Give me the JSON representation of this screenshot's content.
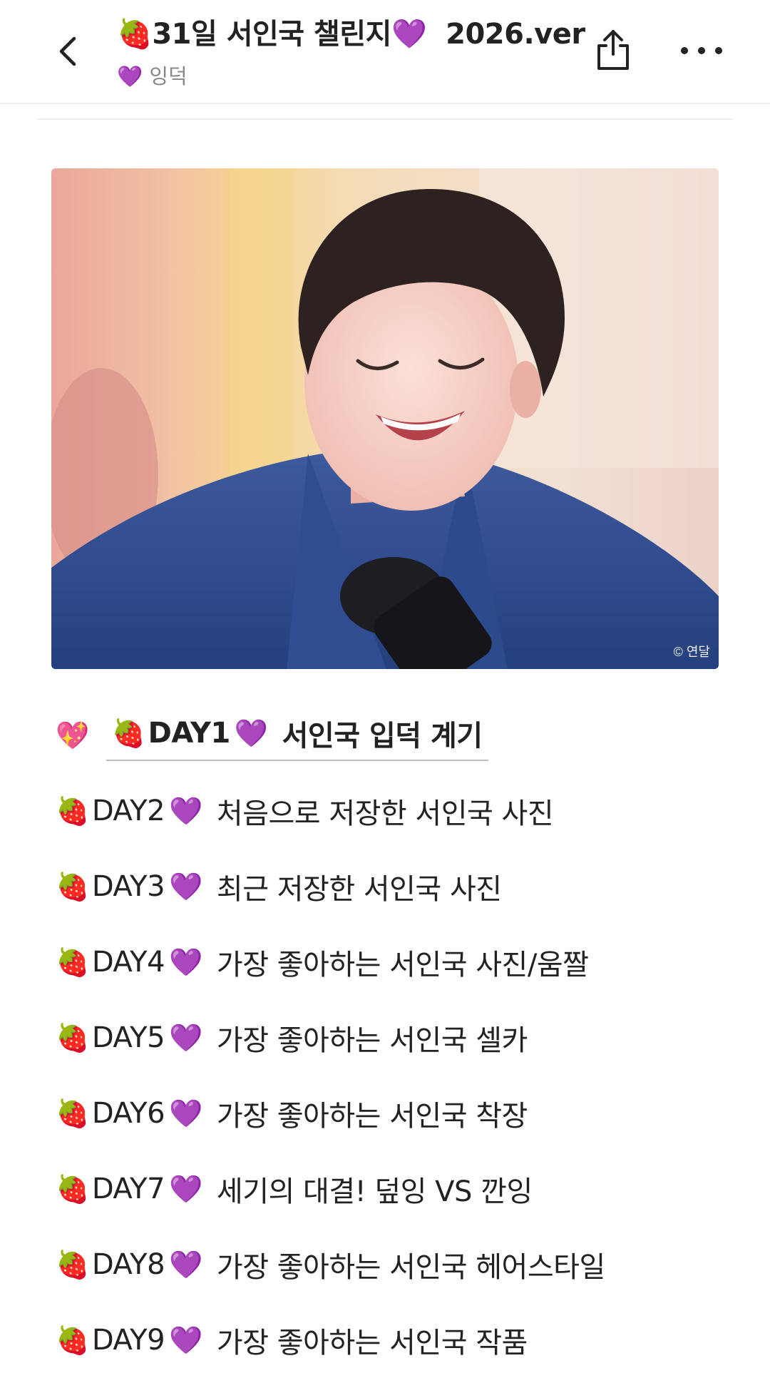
{
  "header": {
    "title_emoji_start": "🍓",
    "title_text": "31일 서인국 챌린지",
    "title_emoji_end": "💜",
    "title_suffix": "2026.ver",
    "subtitle_emoji": "💜",
    "subtitle_text": "잉덕",
    "back_icon": "chevron-left-icon",
    "share_icon": "share-icon",
    "more_icon": "more-horizontal-icon"
  },
  "photo": {
    "watermark": "© 연달"
  },
  "challenge": {
    "first": {
      "prefix_emoji": "💖",
      "emoji": "🍓",
      "day": "DAY1",
      "heart": "💜",
      "text": "서인국 입덕 계기"
    },
    "items": [
      {
        "emoji": "🍓",
        "day": "DAY2",
        "heart": "💜",
        "text": "처음으로 저장한 서인국 사진"
      },
      {
        "emoji": "🍓",
        "day": "DAY3",
        "heart": "💜",
        "text": "최근 저장한 서인국 사진"
      },
      {
        "emoji": "🍓",
        "day": "DAY4",
        "heart": "💜",
        "text": "가장 좋아하는 서인국 사진/움짤"
      },
      {
        "emoji": "🍓",
        "day": "DAY5",
        "heart": "💜",
        "text": "가장 좋아하는 서인국 셀카"
      },
      {
        "emoji": "🍓",
        "day": "DAY6",
        "heart": "💜",
        "text": "가장 좋아하는 서인국 착장"
      },
      {
        "emoji": "🍓",
        "day": "DAY7",
        "heart": "💜",
        "text": "세기의 대결! 덮잉 VS 깐잉"
      },
      {
        "emoji": "🍓",
        "day": "DAY8",
        "heart": "💜",
        "text": "가장 좋아하는 서인국 헤어스타일"
      },
      {
        "emoji": "🍓",
        "day": "DAY9",
        "heart": "💜",
        "text": "가장 좋아하는 서인국 작품"
      }
    ]
  },
  "colors": {
    "text": "#222222",
    "subtext": "#888888",
    "divider": "#ededed",
    "heart_purple": "#9b4fd6",
    "strawberry_red": "#d8283a"
  }
}
